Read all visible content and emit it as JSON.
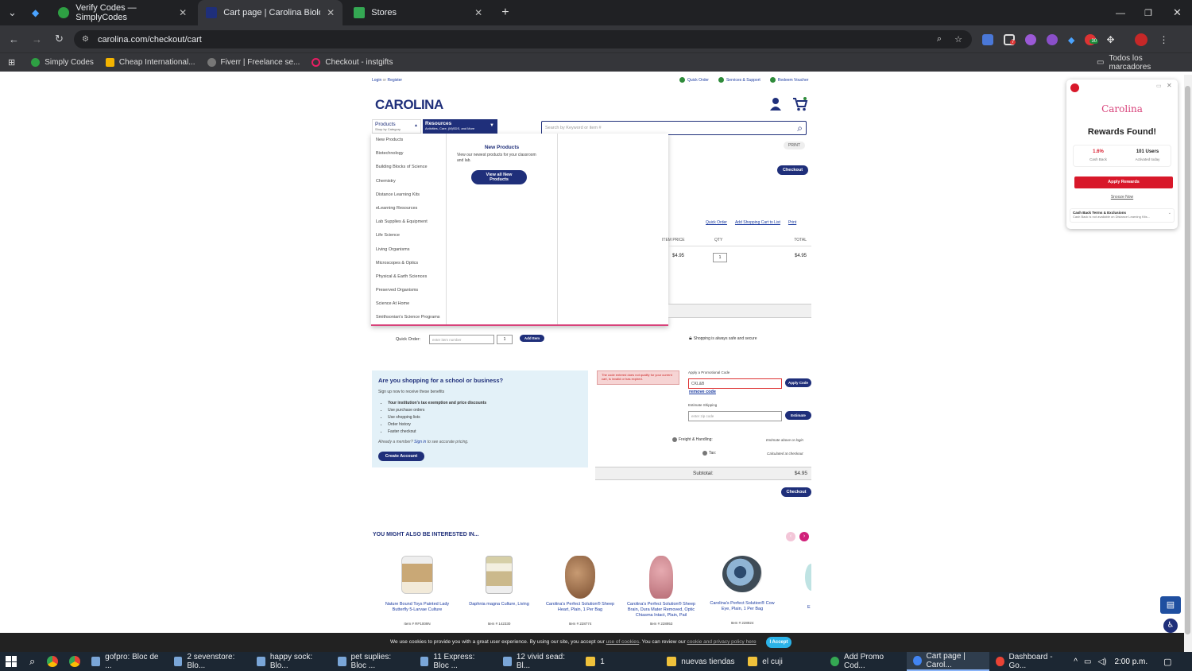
{
  "browser": {
    "tabs": [
      {
        "title": "Verify Codes — SimplyCodes",
        "color": "#2ea043"
      },
      {
        "title": "Cart page | Carolina Biological S",
        "color": "#1f2f7a"
      },
      {
        "title": "Stores",
        "color": "#34a853"
      }
    ],
    "url": "carolina.com/checkout/cart",
    "bookmarks": [
      {
        "label": "Simply Codes",
        "color": "#2ea043"
      },
      {
        "label": "Cheap International...",
        "color": "#f4b400"
      },
      {
        "label": "Fiverr | Freelance se...",
        "color": "#777777"
      },
      {
        "label": "Checkout - instgifts",
        "color": "#e91e63"
      }
    ],
    "all_bookmarks": "Todos los marcadores",
    "ext_badge_1": "7",
    "ext_badge_2": "30"
  },
  "site": {
    "logo": "CAROLINA",
    "top_links": {
      "login": "Login",
      "or": "or",
      "register": "Register",
      "quick_order": "Quick Order",
      "services": "Services & Support",
      "redeem": "Redeem Voucher"
    },
    "nav": {
      "products": "Products",
      "products_sub": "Shop by Category",
      "resources": "Resources",
      "resources_sub": "Activities, Care, (M)SDS, and More"
    },
    "search_placeholder": "Search by Keyword or item #",
    "categories": [
      "New Products",
      "Biotechnology",
      "Building Blocks of Science",
      "Chemistry",
      "Distance Learning Kits",
      "eLearning Resources",
      "Lab Supplies & Equipment",
      "Life Science",
      "Living Organisms",
      "Microscopes & Optics",
      "Physical & Earth Sciences",
      "Preserved Organisms",
      "Science At Home",
      "Smithsonian's Science Programs"
    ],
    "flyout": {
      "title": "New Products",
      "desc": "View our newest products for your classroom and lab.",
      "button": "View all New Products"
    },
    "cart": {
      "print": "PRINT",
      "checkout": "Checkout",
      "links": [
        "Quick Order",
        "Add Shopping Cart to List",
        "Print"
      ],
      "headers": {
        "price": "ITEM PRICE",
        "qty": "QTY",
        "total": "TOTAL"
      },
      "row": {
        "price": "$4.95",
        "qty": "1",
        "total": "$4.95"
      },
      "quick_order_label": "Quick Order:",
      "item_placeholder": "enter item number",
      "qty_default": "1",
      "add_item": "Add Item",
      "secure": "Shopping is always safe and secure"
    },
    "school": {
      "title": "Are you shopping for a school or business?",
      "subtitle": "Sign up now to receive these benefits",
      "benefits": [
        "Your institution's tax exemption and price discounts",
        "Use purchase orders",
        "Use shopping lists",
        "Order history",
        "Faster checkout"
      ],
      "already": "Already a member?",
      "signin": "Sign in",
      "signin_tail": "to see accurate pricing.",
      "create": "Create Account"
    },
    "promo": {
      "error": "The code entered does not qualify for your current cart, is invalid or has expired.",
      "label": "Apply a Promotional Code",
      "value": "CKL&B",
      "apply": "Apply Code",
      "remove": "remove code",
      "ship_label": "Estimate Shipping",
      "zip_placeholder": "enter zip code",
      "estimate": "Estimate"
    },
    "summary": {
      "freight": "Freight & Handling:",
      "freight_val": "Estimate above or login",
      "tax": "Tax:",
      "tax_val": "Calculated at checkout",
      "subtotal": "Subtotal:",
      "subtotal_val": "$4.95",
      "checkout": "Checkout"
    },
    "recommend": {
      "title": "YOU MIGHT ALSO BE INTERESTED IN...",
      "products": [
        {
          "name": "Nature Bound Toys Painted Lady Butterfly 5-Larvae Culture",
          "item": "Item # RP1009N"
        },
        {
          "name": "Daphnia magna Culture, Living",
          "item": "Item # 142330"
        },
        {
          "name": "Carolina's Perfect Solution® Sheep Heart, Plain, 1 Per Bag",
          "item": "Item # 228774"
        },
        {
          "name": "Carolina's Perfect Solution® Sheep Brain, Dura Mater Removed, Optic Chiasma Intact, Plain, Pail",
          "item": "Item # 228953"
        },
        {
          "name": "Carolina's Perfect Solution® Cow Eye, Plain, 1 Per Bag",
          "item": "Item # 228924"
        },
        {
          "name": "E",
          "item": ""
        }
      ]
    },
    "cookie": {
      "text": "We use cookies to provide you with a great user experience. By using our site, you accept our",
      "link1": "use of cookies",
      "mid": ". You can review our",
      "link2": "cookie and privacy policy here",
      "button": "I Accept"
    }
  },
  "rewards": {
    "brand": "Carolina",
    "title": "Rewards Found!",
    "cashback": "1.6%",
    "cashback_label": "Cash Back",
    "users": "101 Users",
    "users_label": "Activated today",
    "apply": "Apply Rewards",
    "snooze": "Snooze Now",
    "terms_title": "Cash Back Terms & Exclusions",
    "terms_text": "Cash Back is not available on Distance Learning Kits..."
  },
  "taskbar": {
    "items": [
      {
        "label": "gofpro: Bloc de ...",
        "color": "#7aa6d8"
      },
      {
        "label": "2 sevenstore: Blo...",
        "color": "#7aa6d8"
      },
      {
        "label": "happy sock: Blo...",
        "color": "#7aa6d8"
      },
      {
        "label": "pet suplies: Bloc ...",
        "color": "#7aa6d8"
      },
      {
        "label": "11 Express: Bloc ...",
        "color": "#7aa6d8"
      },
      {
        "label": "12 vivid sead: Bl...",
        "color": "#7aa6d8"
      },
      {
        "label": "1",
        "color": "#f0c23b"
      },
      {
        "label": "nuevas tiendas",
        "color": "#f0c23b"
      },
      {
        "label": "el cuji",
        "color": "#f0c23b"
      },
      {
        "label": "Add Promo Cod...",
        "color": "#34a853"
      },
      {
        "label": "Cart page | Carol...",
        "color": "#4285f4"
      },
      {
        "label": "Dashboard - Go...",
        "color": "#ea4335"
      }
    ],
    "time": "2:00 p.m."
  }
}
